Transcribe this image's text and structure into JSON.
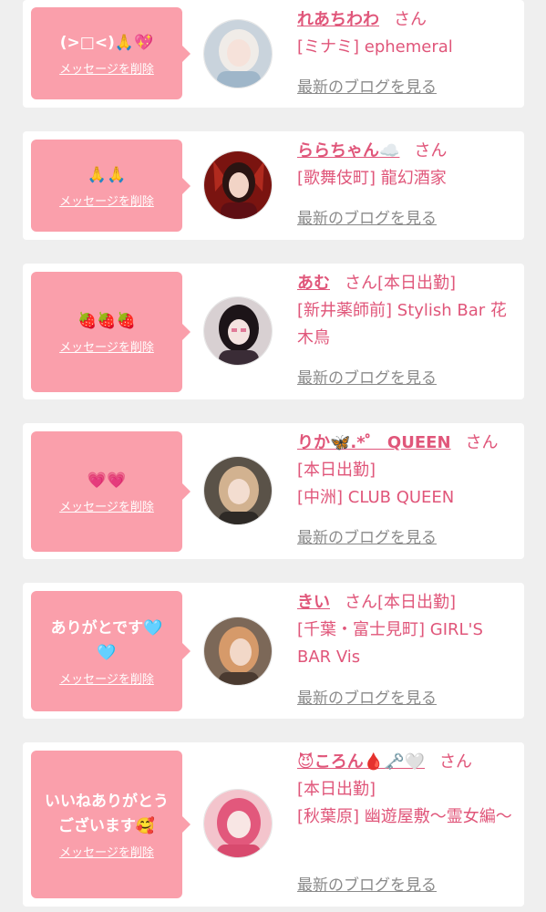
{
  "delete_label": "メッセージを削除",
  "blog_label": "最新のブログを見る",
  "san_label": "さん",
  "colors": {
    "background": "#efefef",
    "card": "#ffffff",
    "bubble": "#fa9fab",
    "accent": "#e0567a",
    "link_gray": "#8a8a8a"
  },
  "cards": [
    {
      "message_lines": [
        "(>□<)🙏💖"
      ],
      "name": "れあちわわ",
      "status": "",
      "shop": "[ミナミ] ephemeral",
      "avatar": {
        "bg": "#c9d3dc",
        "hair": "#f0ece8",
        "skin": "#f6e2da",
        "cloth": "#9fb6c9"
      }
    },
    {
      "message_lines": [
        "🙏🙏"
      ],
      "name": "ららちゃん☁️",
      "status": "",
      "shop": "[歌舞伎町] 龍幻酒家",
      "avatar": {
        "bg": "#7a1410",
        "hair": "#2a1412",
        "skin": "#f2d4c6",
        "cloth": "#5e0f14"
      }
    },
    {
      "message_lines": [
        "🍓🍓🍓"
      ],
      "name": "あむ",
      "status": "[本日出勤]",
      "shop": "[新井薬師前] Stylish Bar 花木鳥",
      "avatar": {
        "bg": "#d8d0d2",
        "hair": "#1c1418",
        "skin": "#f4e3e0",
        "cloth": "#3a2c36"
      }
    },
    {
      "message_lines": [
        "💗💗"
      ],
      "name": "りか🦋.*゜ QUEEN",
      "status": "[本日出勤]",
      "shop": "[中洲] CLUB QUEEN",
      "avatar": {
        "bg": "#5a5248",
        "hair": "#d2b290",
        "skin": "#f3ddd0",
        "cloth": "#2e2a26"
      }
    },
    {
      "message_lines": [
        "ありがとです🩵",
        "🩵"
      ],
      "name": "きい",
      "status": "[本日出勤]",
      "shop": "[千葉・富士見町] GIRL'S BAR Vis",
      "avatar": {
        "bg": "#7c6858",
        "hair": "#d69a6a",
        "skin": "#f2d8c8",
        "cloth": "#4a3a30"
      }
    },
    {
      "message_lines": [
        "いいねありがとう",
        "ございます🥰"
      ],
      "name": "😈ころん🩸🗝️🤍",
      "status": "[本日出勤]",
      "shop": "[秋葉原] 幽遊屋敷〜霊女編〜",
      "avatar": {
        "bg": "#f3c4cc",
        "hair": "#e2587c",
        "skin": "#f8e6e4",
        "cloth": "#d84a6e"
      }
    }
  ]
}
